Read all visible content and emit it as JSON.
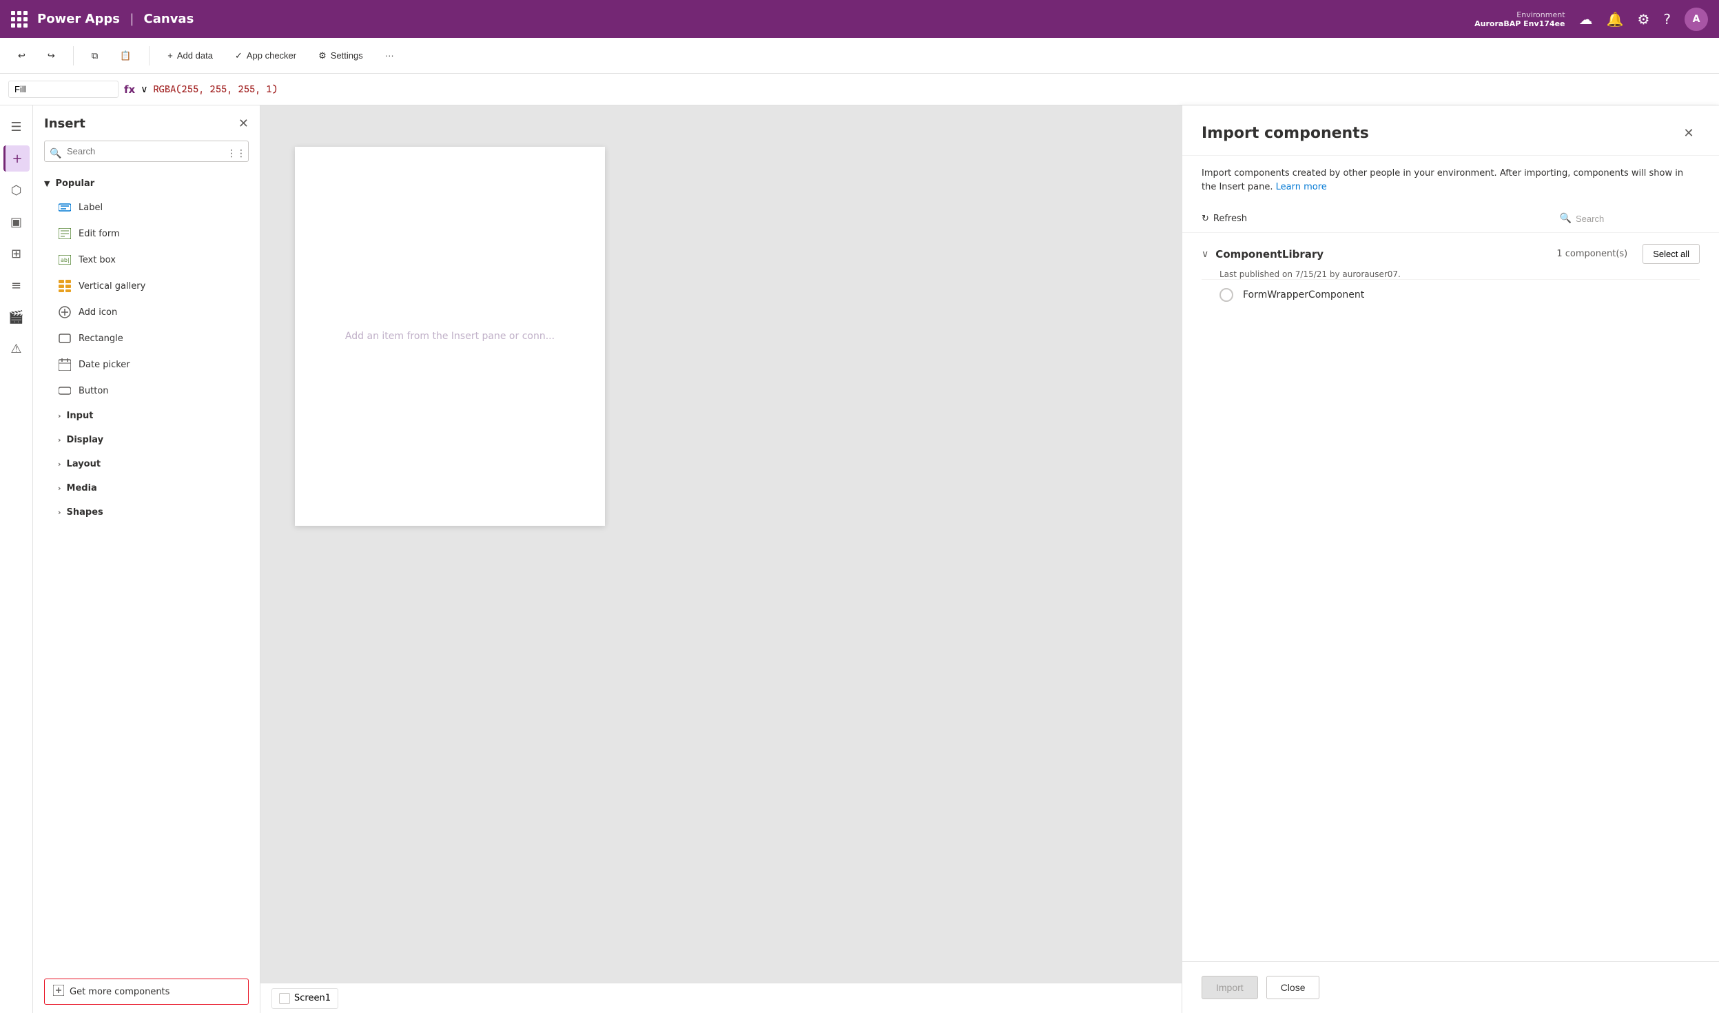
{
  "topbar": {
    "app_name": "Power Apps",
    "divider": "|",
    "canvas_label": "Canvas",
    "env_label": "Environment",
    "env_name": "AuroraBAP Env174ee",
    "avatar_initials": "A"
  },
  "toolbar": {
    "undo_label": "Undo",
    "redo_label": "Redo",
    "add_data_label": "Add data",
    "app_checker_label": "App checker",
    "settings_label": "Settings"
  },
  "formula_bar": {
    "fill_label": "Fill",
    "fx_symbol": "fx",
    "formula_value": "RGBA(255, 255, 255, 1)"
  },
  "insert_panel": {
    "title": "Insert",
    "search_placeholder": "Search",
    "popular_label": "Popular",
    "items": [
      {
        "label": "Label",
        "icon": "🏷"
      },
      {
        "label": "Edit form",
        "icon": "📋"
      },
      {
        "label": "Text box",
        "icon": "📝"
      },
      {
        "label": "Vertical gallery",
        "icon": "📊"
      },
      {
        "label": "Add icon",
        "icon": "+"
      },
      {
        "label": "Rectangle",
        "icon": "⬜"
      },
      {
        "label": "Date picker",
        "icon": "📅"
      },
      {
        "label": "Button",
        "icon": "🔲"
      }
    ],
    "subsections": [
      {
        "label": "Input"
      },
      {
        "label": "Display"
      },
      {
        "label": "Layout"
      },
      {
        "label": "Media"
      },
      {
        "label": "Shapes"
      }
    ],
    "get_more_label": "Get more components"
  },
  "canvas": {
    "placeholder_text": "Add an item from the Insert pane or conn...",
    "screen_tab_label": "Screen1"
  },
  "import_panel": {
    "title": "Import components",
    "description": "Import components created by other people in your environment. After importing, components will show in the Insert pane.",
    "learn_more_label": "Learn more",
    "refresh_label": "Refresh",
    "search_placeholder": "Search",
    "library_name": "ComponentLibrary",
    "library_meta": "Last published on 7/15/21 by aurorauser07.",
    "component_count": "1 component(s)",
    "select_all_label": "Select all",
    "components": [
      {
        "name": "FormWrapperComponent"
      }
    ],
    "import_btn_label": "Import",
    "close_btn_label": "Close"
  }
}
